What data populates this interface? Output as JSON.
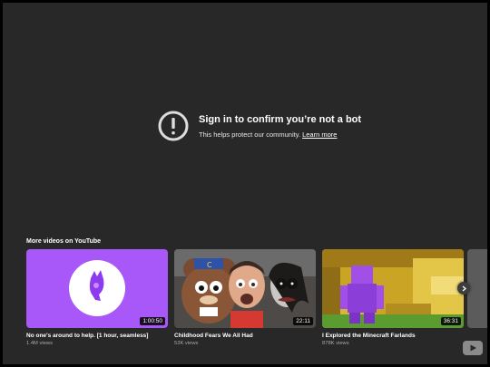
{
  "notice": {
    "title": "Sign in to confirm you’re not a bot",
    "subtitle": "This helps protect our community.",
    "link": "Learn more"
  },
  "more": {
    "heading": "More videos on YouTube",
    "videos": [
      {
        "title": "No one's around to help. [1 hour, seamless]",
        "views": "1.4M views",
        "duration": "1:00:50",
        "thumb_bg": "#a857f8"
      },
      {
        "title": "Childhood Fears We All Had",
        "views": "53K views",
        "duration": "22:11",
        "thumb_bg": "#4d4a48"
      },
      {
        "title": "I Explored the Minecraft Farlands",
        "views": "878K views",
        "duration": "36:31",
        "thumb_bg": "#c9a425"
      }
    ]
  },
  "icons": {
    "alert": "alert-circle-icon",
    "next": "chevron-right-icon",
    "logo": "youtube-logo-icon"
  }
}
